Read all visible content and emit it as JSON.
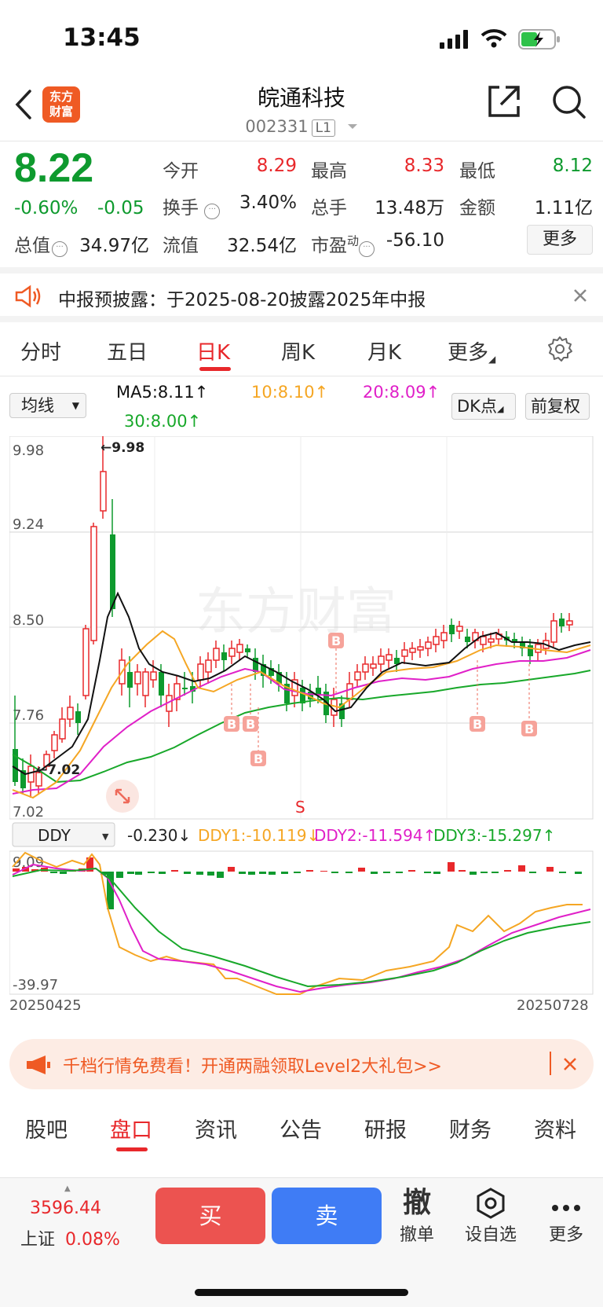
{
  "status_bar": {
    "time": "13:45"
  },
  "header": {
    "logo_text_line1": "东方",
    "logo_text_line2": "财富",
    "stock_name": "皖通科技",
    "stock_code": "002331",
    "level_badge": "L1"
  },
  "quote": {
    "price": "8.22",
    "change_pct": "-0.60%",
    "change_amt": "-0.05",
    "open_label": "今开",
    "open_value": "8.29",
    "high_label": "最高",
    "high_value": "8.33",
    "low_label": "最低",
    "low_value": "8.12",
    "turnover_label": "换手",
    "turnover_value": "3.40%",
    "volume_label": "总手",
    "volume_value": "13.48万",
    "amount_label": "金额",
    "amount_value": "1.11亿",
    "total_mv_label": "总值",
    "total_mv_value": "34.97亿",
    "float_mv_label": "流值",
    "float_mv_value": "32.54亿",
    "pe_label": "市盈",
    "pe_sup": "动",
    "pe_value": "-56.10",
    "more_label": "更多"
  },
  "notice": {
    "text": "中报预披露：于2025-08-20披露2025年中报"
  },
  "kline_tabs": [
    {
      "label": "分时"
    },
    {
      "label": "五日"
    },
    {
      "label": "日K"
    },
    {
      "label": "周K"
    },
    {
      "label": "月K"
    },
    {
      "label": "更多"
    }
  ],
  "indicator_row": {
    "ma_select": "均线",
    "ma5": "MA5:8.11",
    "ma10": "10:8.10",
    "ma20": "20:8.09",
    "ma30": "30:8.00",
    "dk_label": "DK点",
    "adjust_label": "前复权"
  },
  "ddy_row": {
    "select": "DDY",
    "ddy": "-0.230",
    "ddy1": "DDY1:-10.119",
    "ddy2": "DDY2:-11.594",
    "ddy3": "DDY3:-15.297"
  },
  "chart_data": {
    "type": "candlestick",
    "y_axis_labels": [
      "9.98",
      "9.24",
      "8.50",
      "7.76",
      "7.02"
    ],
    "max_marker": "9.98",
    "min_marker": "7.02",
    "signal_labels": [
      "B",
      "B",
      "B",
      "B",
      "B",
      "B",
      "S"
    ],
    "sub_axis_labels": [
      "9.09",
      "-39.97"
    ],
    "x_labels": [
      "20250425",
      "20250728"
    ],
    "watermark": "东方财富",
    "colors": {
      "up": "#e8282b",
      "down": "#0e9a2e",
      "ma5": "#111111",
      "ma10": "#f5a623",
      "ma20": "#e020c8",
      "ma30": "#18a82a"
    }
  },
  "ad_bar": {
    "text": "千档行情免费看！开通两融领取Level2大礼包>>"
  },
  "bottom_tabs": [
    {
      "label": "股吧"
    },
    {
      "label": "盘口"
    },
    {
      "label": "资讯"
    },
    {
      "label": "公告"
    },
    {
      "label": "研报"
    },
    {
      "label": "财务"
    },
    {
      "label": "资料"
    }
  ],
  "footer": {
    "index_value": "3596.44",
    "index_name": "上证",
    "index_change": "0.08%",
    "buy_label": "买",
    "sell_label": "卖",
    "cancel_glyph": "撤",
    "cancel_label": "撤单",
    "watchlist_label": "设自选",
    "more_label": "更多"
  }
}
